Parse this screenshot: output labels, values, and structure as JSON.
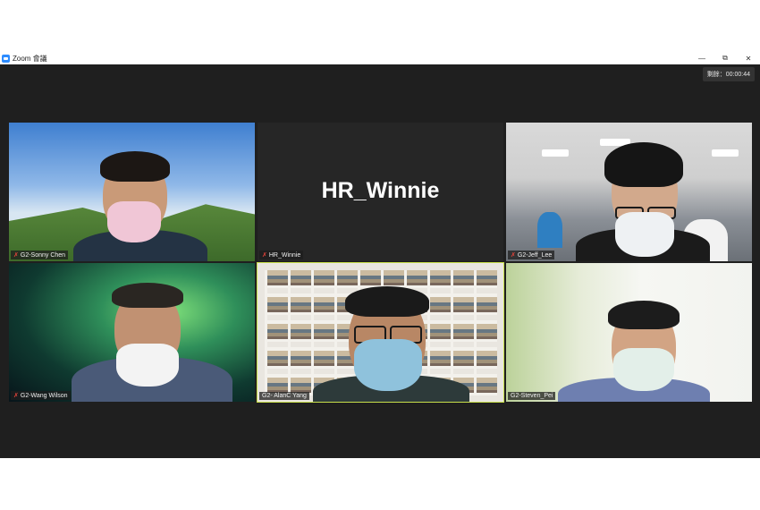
{
  "window": {
    "app_name": "Zoom 會議",
    "controls": {
      "minimize": "—",
      "restore": "⧉",
      "close": "✕"
    }
  },
  "meeting": {
    "timer_label": "剩餘：00:00:44",
    "participants": [
      {
        "name": "G2-Sonny Chen",
        "muted": true,
        "video": true
      },
      {
        "name": "HR_Winnie",
        "muted": true,
        "video": false,
        "display_text": "HR_Winnie"
      },
      {
        "name": "G2-Jeff_Lee",
        "muted": true,
        "video": true
      },
      {
        "name": "G2-Wang Wilson",
        "muted": true,
        "video": true
      },
      {
        "name": "G2- AlanC Yang",
        "muted": false,
        "video": true,
        "active_speaker": true
      },
      {
        "name": "G2-Steven_Pei",
        "muted": false,
        "video": true
      }
    ]
  },
  "colors": {
    "meeting_bg": "#1f1f1f",
    "active_speaker_border": "#c8e04a",
    "mute_red": "#e0433a",
    "zoom_blue": "#2d8cff"
  }
}
